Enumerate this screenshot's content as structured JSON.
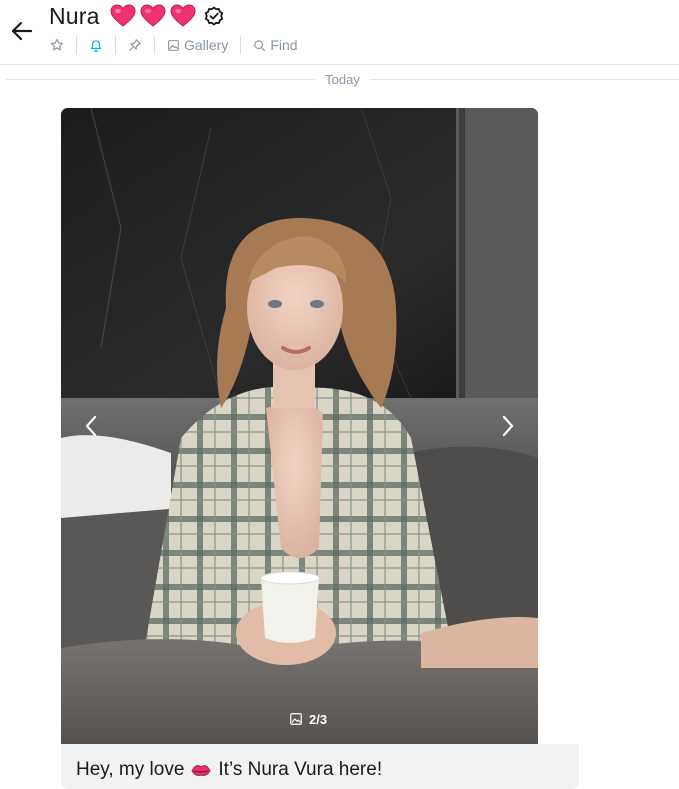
{
  "header": {
    "contact_name": "Nura",
    "back_icon": "arrow-left-icon",
    "badges": [
      "heart-icon",
      "heart-icon",
      "heart-icon",
      "verified-icon"
    ],
    "toolbar": {
      "star_icon": "star-icon",
      "bell_icon": "bell-icon",
      "pin_icon": "pin-icon",
      "gallery_label": "Gallery",
      "find_label": "Find"
    }
  },
  "divider": {
    "date_label": "Today"
  },
  "message": {
    "media_counter": "2/3",
    "media_current": 2,
    "media_total": 3,
    "text_before": "Hey, my love",
    "text_after": "It’s Nura Vura here!"
  },
  "colors": {
    "accent": "#00aff0",
    "muted": "#8a96a3",
    "heart": "#f0336f",
    "bubble": "#f0f2f4"
  }
}
